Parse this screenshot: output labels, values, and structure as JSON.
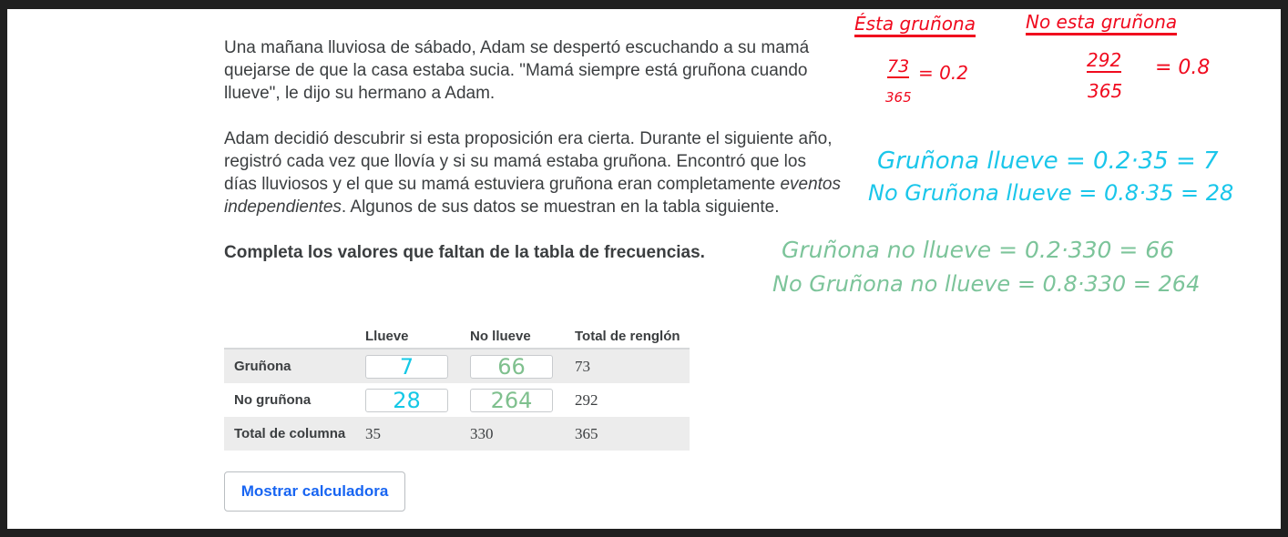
{
  "problem": {
    "paragraph1": "Una mañana lluviosa de sábado, Adam se despertó escuchando a su mamá quejarse de que la casa estaba sucia. \"Mamá siempre está gruñona cuando llueve\", le dijo su hermano a Adam.",
    "paragraph2_before": "Adam decidió descubrir si esta proposición era cierta. Durante el siguiente año, registró cada vez que llovía y si su mamá estaba gruñona. Encontró que los días lluviosos y el que su mamá estuviera gruñona eran completamente ",
    "paragraph2_emphasis": "eventos independientes",
    "paragraph2_after": ". Algunos de sus datos se muestran en la tabla siguiente.",
    "instruction": "Completa los valores que faltan de la tabla de frecuencias."
  },
  "table": {
    "headers": [
      "",
      "Llueve",
      "No llueve",
      "Total de renglón"
    ],
    "rows": [
      {
        "label": "Gruñona",
        "llueve_input": "7",
        "no_llueve_input": "66",
        "total": "73"
      },
      {
        "label": "No gruñona",
        "llueve_input": "28",
        "no_llueve_input": "264",
        "total": "292"
      },
      {
        "label": "Total de columna",
        "llueve": "35",
        "no_llueve": "330",
        "total": "365"
      }
    ]
  },
  "calculator_button": "Mostrar calculadora",
  "annotations": {
    "red_heading_1": "Ésta gruñona",
    "red_heading_2": "No esta gruñona",
    "red_frac_1_num": "73",
    "red_frac_1_den": "365",
    "red_frac_1_result": "= 0.2",
    "red_frac_2_num": "292",
    "red_frac_2_den": "365",
    "red_frac_2_result": "= 0.8",
    "cyan_line_1": "Gruñona llueve = 0.2·35 = 7",
    "cyan_line_2": "No Gruñona llueve = 0.8·35 = 28",
    "green_line_1": "Gruñona no llueve = 0.2·330 = 66",
    "green_line_2": "No Gruñona no llueve = 0.8·330 = 264"
  },
  "colors": {
    "annotation_red": "#f00a1e",
    "annotation_cyan": "#1ac6ea",
    "annotation_green": "#7cc49a",
    "link_blue": "#1865f2"
  }
}
